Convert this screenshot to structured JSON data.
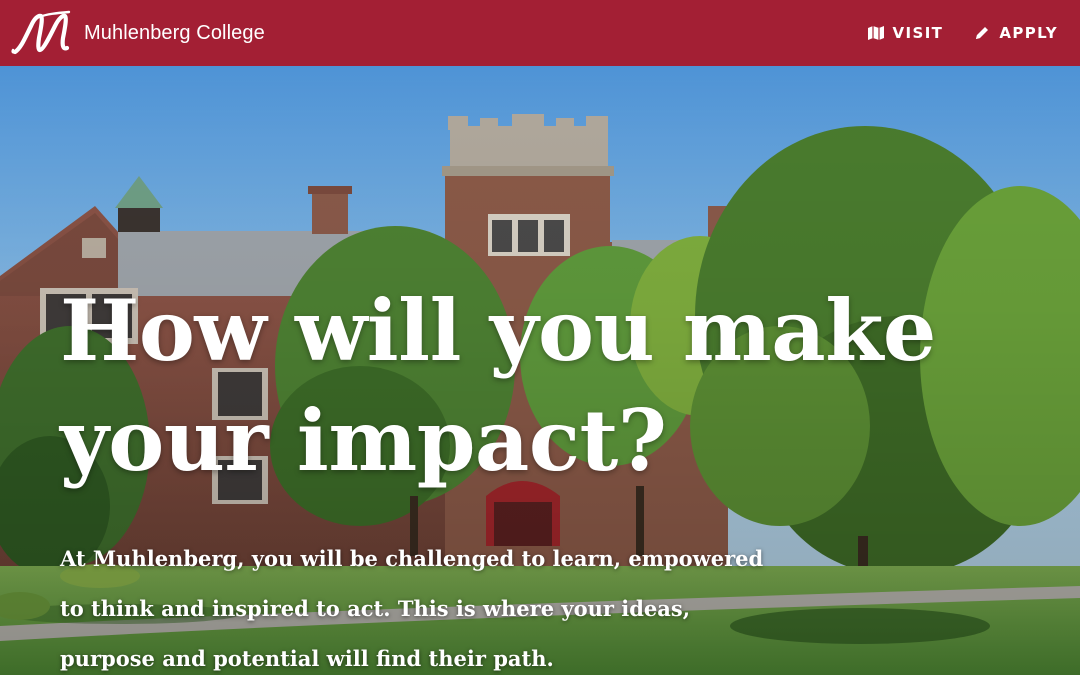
{
  "header": {
    "brand_name": "Muhlenberg College",
    "logo_icon": "muhlenberg-m-logo",
    "background_color": "#a31f34",
    "nav": [
      {
        "label": "VISIT",
        "icon": "map-icon"
      },
      {
        "label": "APPLY",
        "icon": "pencil-icon"
      }
    ]
  },
  "hero": {
    "heading_line1": "How will you make",
    "heading_line2": "your impact?",
    "body_line1": "At Muhlenberg, you will be challenged to learn, empowered",
    "body_line2": "to think and inspired to act. This is where your ideas,",
    "body_line3": "purpose and potential will find their path."
  }
}
